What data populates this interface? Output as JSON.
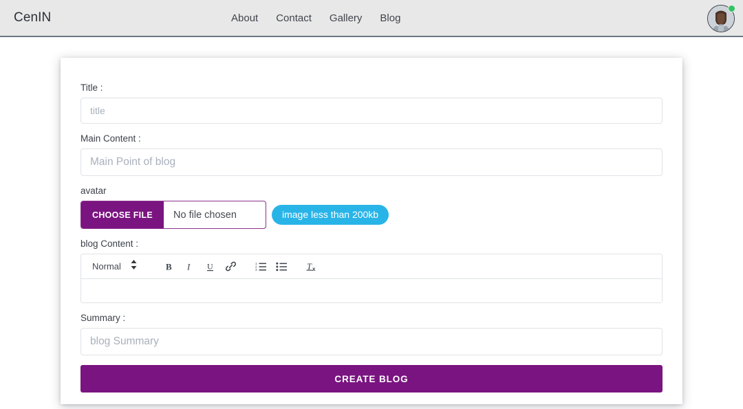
{
  "navbar": {
    "brand": "CenIN",
    "links": [
      {
        "label": "About",
        "name": "nav-link-about"
      },
      {
        "label": "Contact",
        "name": "nav-link-contact"
      },
      {
        "label": "Gallery",
        "name": "nav-link-gallery"
      },
      {
        "label": "Blog",
        "name": "nav-link-blog"
      }
    ],
    "avatar_icon": "user-avatar-icon",
    "status_icon": "online-status-dot",
    "status_color": "#30c463",
    "background": "#e8e8e8"
  },
  "form": {
    "title_field": {
      "label": "Title :",
      "placeholder": "title",
      "value": ""
    },
    "main_content_field": {
      "label": "Main Content :",
      "placeholder": "Main Point of blog",
      "value": ""
    },
    "avatar_field": {
      "label": "avatar",
      "choose_button": "CHOOSE FILE",
      "file_status": "No file chosen",
      "hint_badge": "image less than 200kb",
      "badge_color": "#29b4e8"
    },
    "blog_content_field": {
      "label": "blog Content :",
      "toolbar": {
        "format_picker": "Normal",
        "picker_icon": "chevron-updown-icon",
        "buttons": [
          {
            "label": "B",
            "name": "bold-icon"
          },
          {
            "label": "I",
            "name": "italic-icon"
          },
          {
            "label": "U",
            "name": "underline-icon"
          },
          {
            "label": "",
            "name": "link-icon"
          },
          {
            "label": "",
            "name": "ordered-list-icon"
          },
          {
            "label": "",
            "name": "bullet-list-icon"
          },
          {
            "label": "",
            "name": "clear-format-icon"
          }
        ]
      },
      "body_value": ""
    },
    "summary_field": {
      "label": "Summary :",
      "placeholder": "blog Summary",
      "value": ""
    },
    "submit_button": "CREATE BLOG",
    "accent_color": "#7a1480"
  }
}
